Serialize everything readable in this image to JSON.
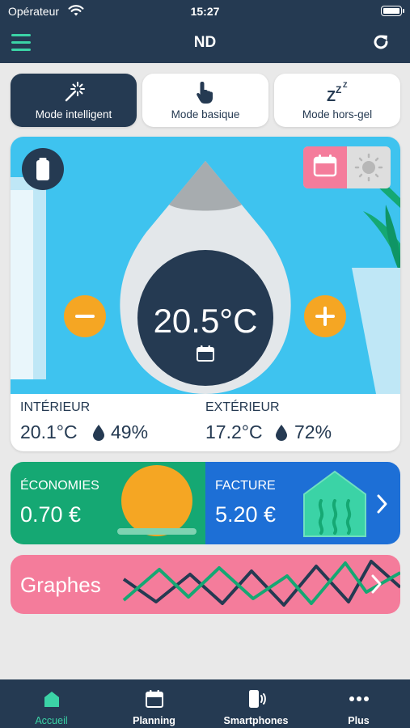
{
  "status_bar": {
    "carrier": "Opérateur",
    "time": "15:27"
  },
  "header": {
    "title": "ND"
  },
  "modes": [
    {
      "label": "Mode intelligent",
      "icon": "magic-wand-icon",
      "active": true
    },
    {
      "label": "Mode basique",
      "icon": "hand-pointer-icon",
      "active": false
    },
    {
      "label": "Mode hors-gel",
      "icon": "sleep-zzz-icon",
      "active": false
    }
  ],
  "thermostat": {
    "setpoint": "20.5°C",
    "interior": {
      "label": "INTÉRIEUR",
      "temp": "20.1°C",
      "humidity": "49%"
    },
    "exterior": {
      "label": "EXTÉRIEUR",
      "temp": "17.2°C",
      "humidity": "72%"
    }
  },
  "savings": {
    "label": "ÉCONOMIES",
    "amount": "0.70 €"
  },
  "bill": {
    "label": "FACTURE",
    "amount": "5.20 €"
  },
  "graphs": {
    "label": "Graphes"
  },
  "tabs": [
    {
      "label": "Accueil",
      "icon": "home-icon",
      "active": true
    },
    {
      "label": "Planning",
      "icon": "calendar-icon",
      "active": false
    },
    {
      "label": "Smartphones",
      "icon": "smartphone-icon",
      "active": false
    },
    {
      "label": "Plus",
      "icon": "more-dots-icon",
      "active": false
    }
  ],
  "colors": {
    "navy": "#253a52",
    "accent_green": "#3bd3a6",
    "sky": "#3ec3ef",
    "savings_green": "#15a873",
    "bill_blue": "#1d6fd6",
    "graphs_pink": "#f47c9b",
    "orange": "#f5a623"
  }
}
